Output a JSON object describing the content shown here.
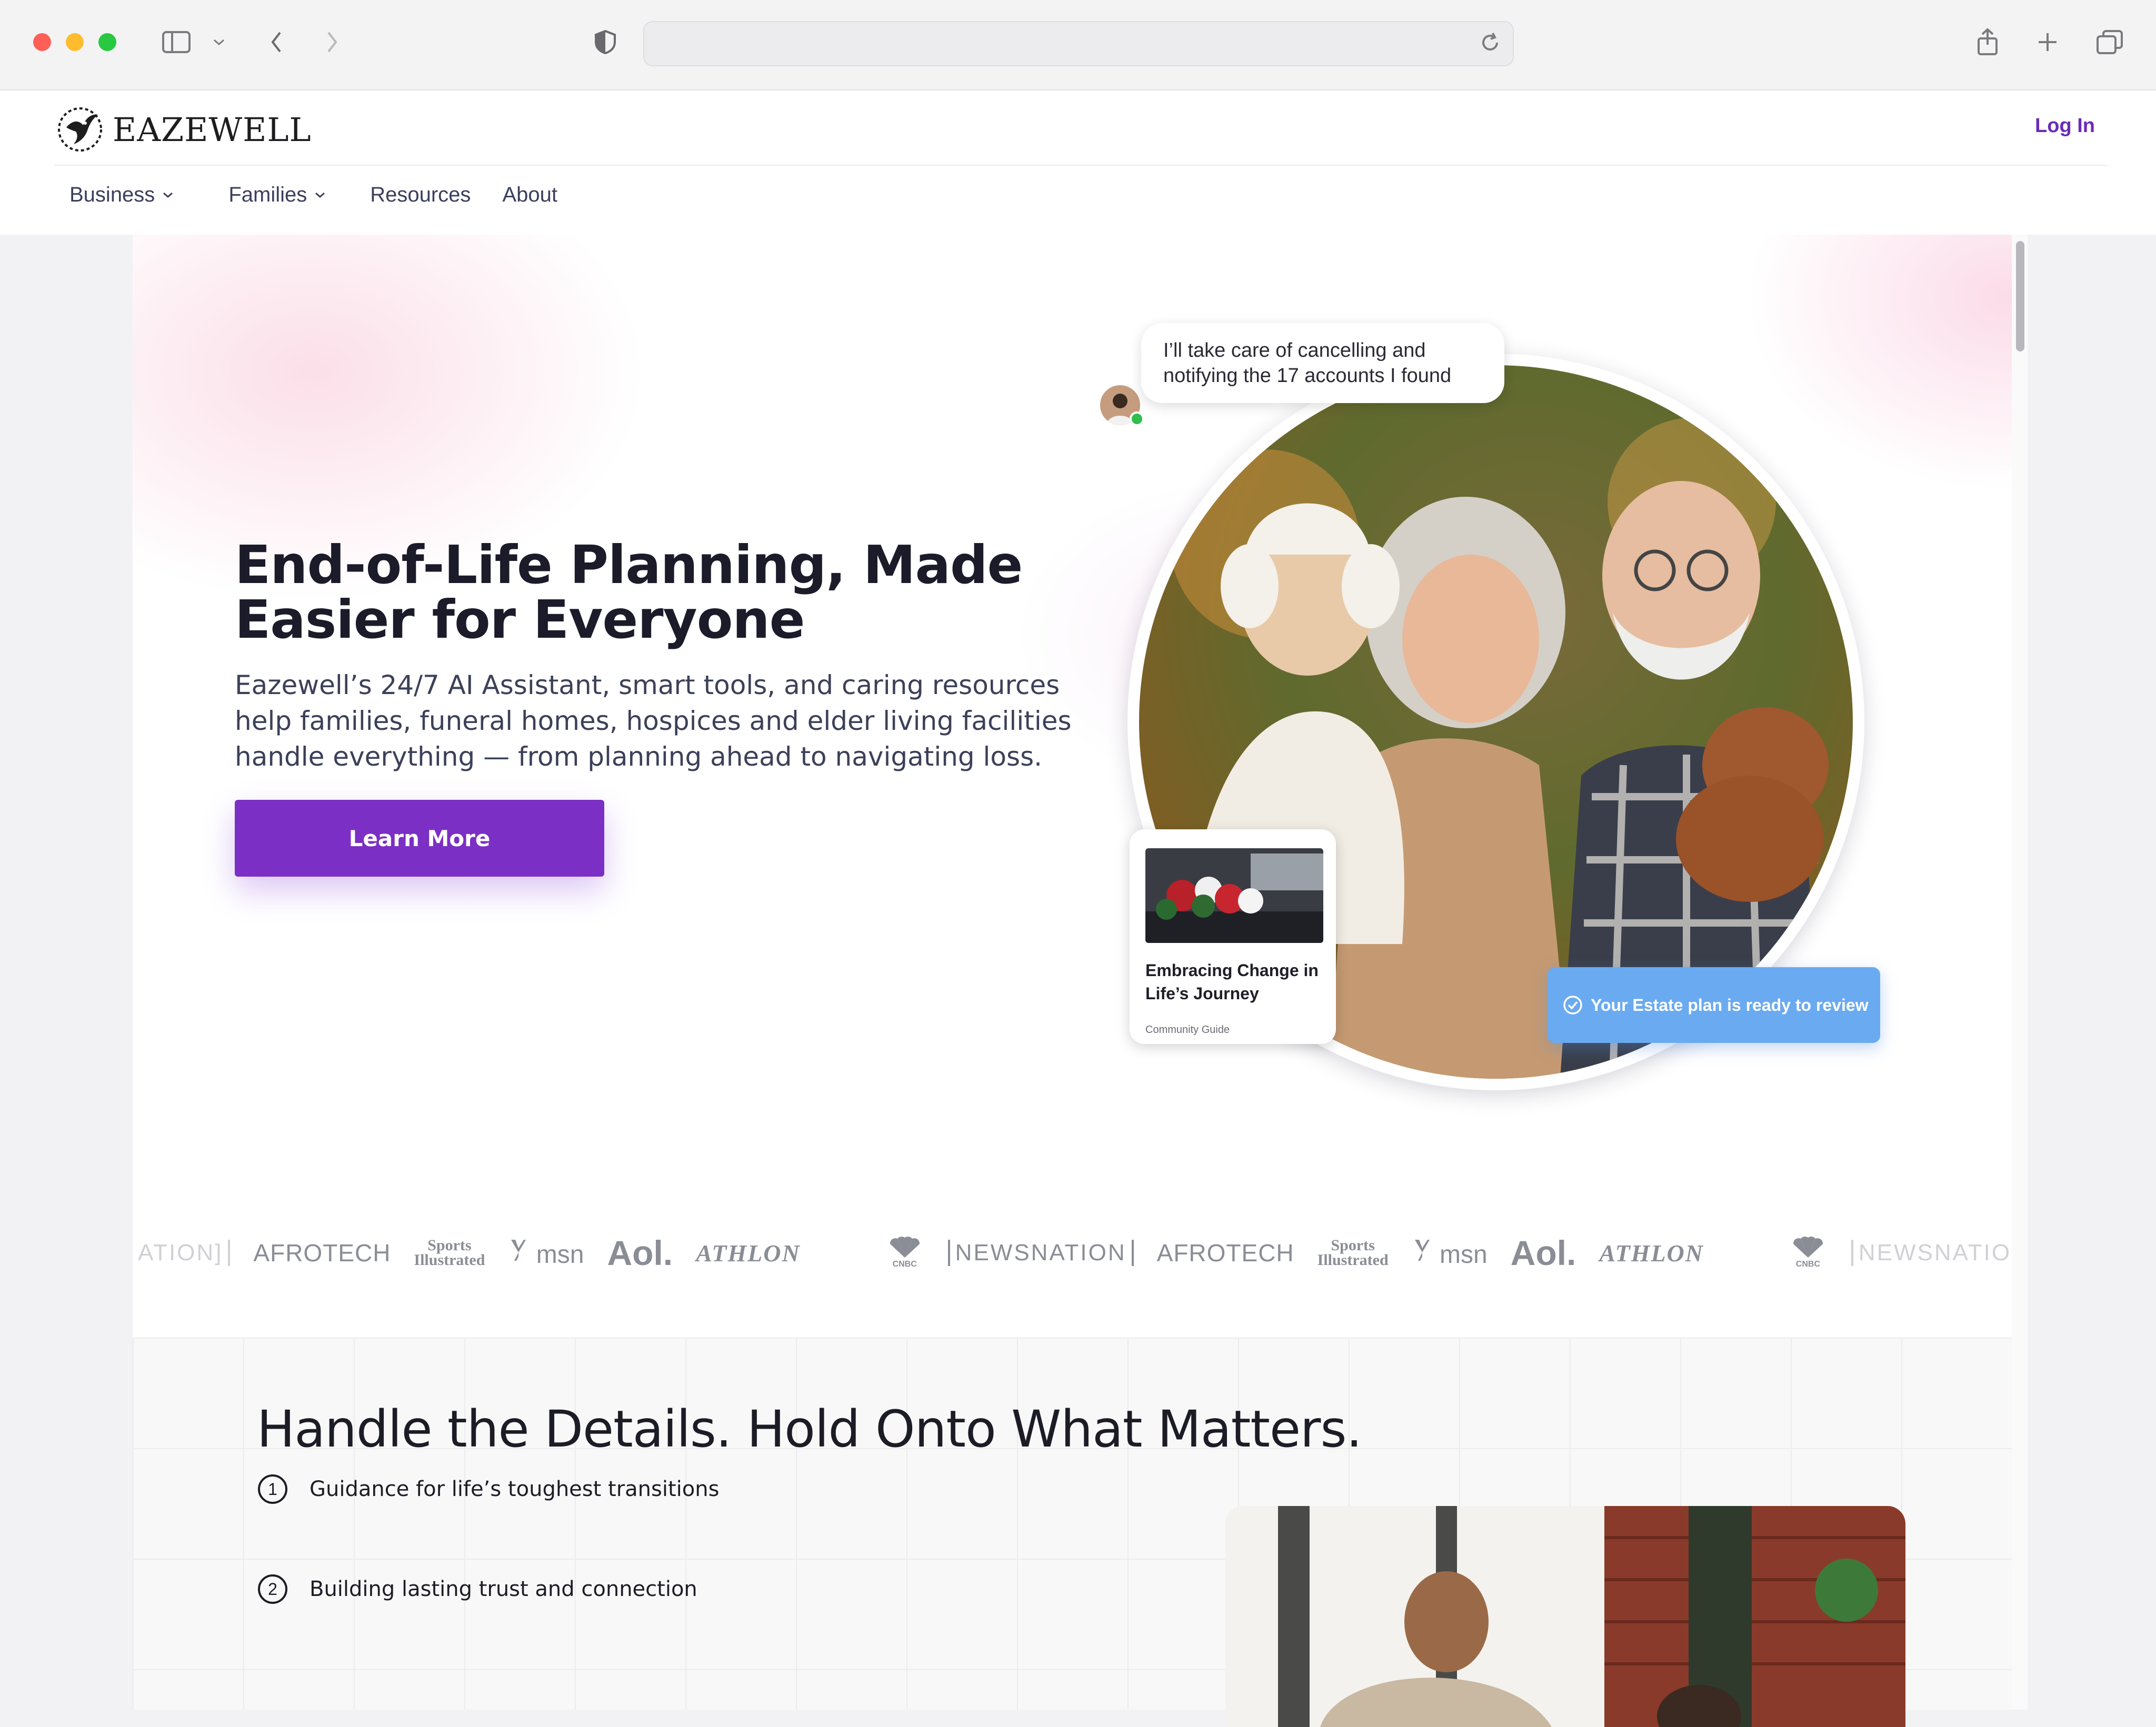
{
  "site": {
    "brand": "EAZEWELL",
    "login_label": "Log In",
    "nav": [
      {
        "label": "Business",
        "has_dropdown": true
      },
      {
        "label": "Families",
        "has_dropdown": true
      },
      {
        "label": "Resources",
        "has_dropdown": false
      },
      {
        "label": "About",
        "has_dropdown": false
      }
    ]
  },
  "hero": {
    "title": "End-of-Life Planning, Made Easier for Everyone",
    "subtitle": "Eazewell’s 24/7 AI Assistant, smart tools, and caring resources help families, funeral homes, hospices and elder living facilities handle everything — from planning ahead to navigating loss.",
    "cta_label": "Learn More",
    "chat_message": "I’ll take care of cancelling and notifying the 17 accounts I found",
    "guide_card": {
      "kicker": "Community Guide",
      "title": "Embracing Change in Life’s Journey"
    },
    "estate_notice": "Your Estate plan is ready to review"
  },
  "press_logos": {
    "fragment_start": "ATION]",
    "afrotech": "AFROTECH",
    "si_line1": "Sports",
    "si_line2": "Illustrated",
    "msn": "msn",
    "aol": "Aol.",
    "athlon": "ATHLON",
    "cnbc": "CNBC",
    "newsnation": "NEWSNATION"
  },
  "section2": {
    "title": "Handle the Details. Hold Onto What Matters.",
    "items": [
      {
        "number": "1",
        "label": "Guidance for life’s toughest transitions"
      },
      {
        "number": "2",
        "label": "Building lasting trust and connection"
      }
    ]
  },
  "colors": {
    "accent": "#7b2fc4",
    "login": "#6b2bb8",
    "estate_pill": "#6aaaf0",
    "online": "#2fbe4f"
  },
  "icons": [
    "sidebar-icon",
    "chevron-down-icon",
    "back-icon",
    "forward-icon",
    "shield-icon",
    "reload-icon",
    "share-icon",
    "plus-icon",
    "tabs-icon",
    "check-circle-icon"
  ]
}
